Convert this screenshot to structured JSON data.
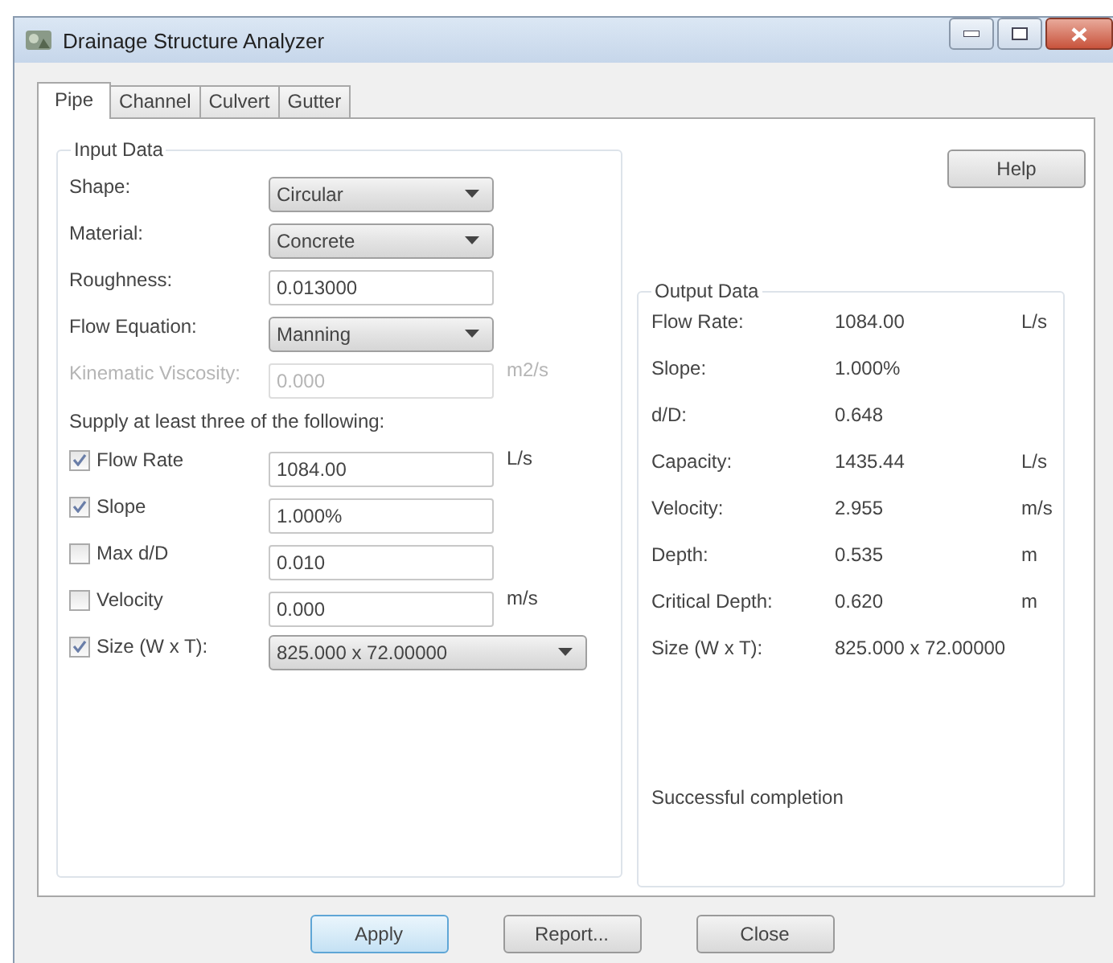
{
  "window": {
    "title": "Drainage Structure Analyzer"
  },
  "tabs": [
    {
      "label": "Pipe",
      "selected": true
    },
    {
      "label": "Channel",
      "selected": false
    },
    {
      "label": "Culvert",
      "selected": false
    },
    {
      "label": "Gutter",
      "selected": false
    }
  ],
  "help_button": "Help",
  "input_data": {
    "title": "Input Data",
    "fields": [
      {
        "kind": "dropdown",
        "label": "Shape:",
        "value": "Circular",
        "disabled": false
      },
      {
        "kind": "dropdown",
        "label": "Material:",
        "value": "Concrete",
        "disabled": false
      },
      {
        "kind": "textbox",
        "label": "Roughness:",
        "value": "0.013000",
        "disabled": false
      },
      {
        "kind": "dropdown",
        "label": "Flow Equation:",
        "value": "Manning",
        "disabled": false
      },
      {
        "kind": "textbox",
        "label": "Kinematic Viscosity:",
        "value": "0.000",
        "unit": "m2/s",
        "disabled": true
      }
    ],
    "supply_note": "Supply at least three of the following:",
    "options": [
      {
        "kind": "textbox",
        "label": "Flow Rate",
        "checked": true,
        "value": "1084.00",
        "unit": "L/s"
      },
      {
        "kind": "textbox",
        "label": "Slope",
        "checked": true,
        "value": "1.000%"
      },
      {
        "kind": "textbox",
        "label": "Max d/D",
        "checked": false,
        "value": "0.010"
      },
      {
        "kind": "textbox",
        "label": "Velocity",
        "checked": false,
        "value": "0.000",
        "unit": "m/s"
      },
      {
        "kind": "dropdown",
        "label": "Size (W x T):",
        "checked": true,
        "value": "825.000 x 72.00000"
      }
    ]
  },
  "output_data": {
    "title": "Output Data",
    "rows": [
      {
        "label": "Flow Rate:",
        "value": "1084.00",
        "unit": "L/s"
      },
      {
        "label": "Slope:",
        "value": "1.000%"
      },
      {
        "label": "d/D:",
        "value": "0.648"
      },
      {
        "label": "Capacity:",
        "value": "1435.44",
        "unit": "L/s"
      },
      {
        "label": "Velocity:",
        "value": "2.955",
        "unit": "m/s"
      },
      {
        "label": "Depth:",
        "value": "0.535",
        "unit": "m"
      },
      {
        "label": "Critical Depth:",
        "value": "0.620",
        "unit": "m"
      },
      {
        "label": "Size (W x T):",
        "value": "825.000 x 72.00000"
      }
    ],
    "status": "Successful completion"
  },
  "buttons": [
    {
      "label": "Apply",
      "focused": true
    },
    {
      "label": "Report...",
      "focused": false
    },
    {
      "label": "Close",
      "focused": false
    }
  ]
}
